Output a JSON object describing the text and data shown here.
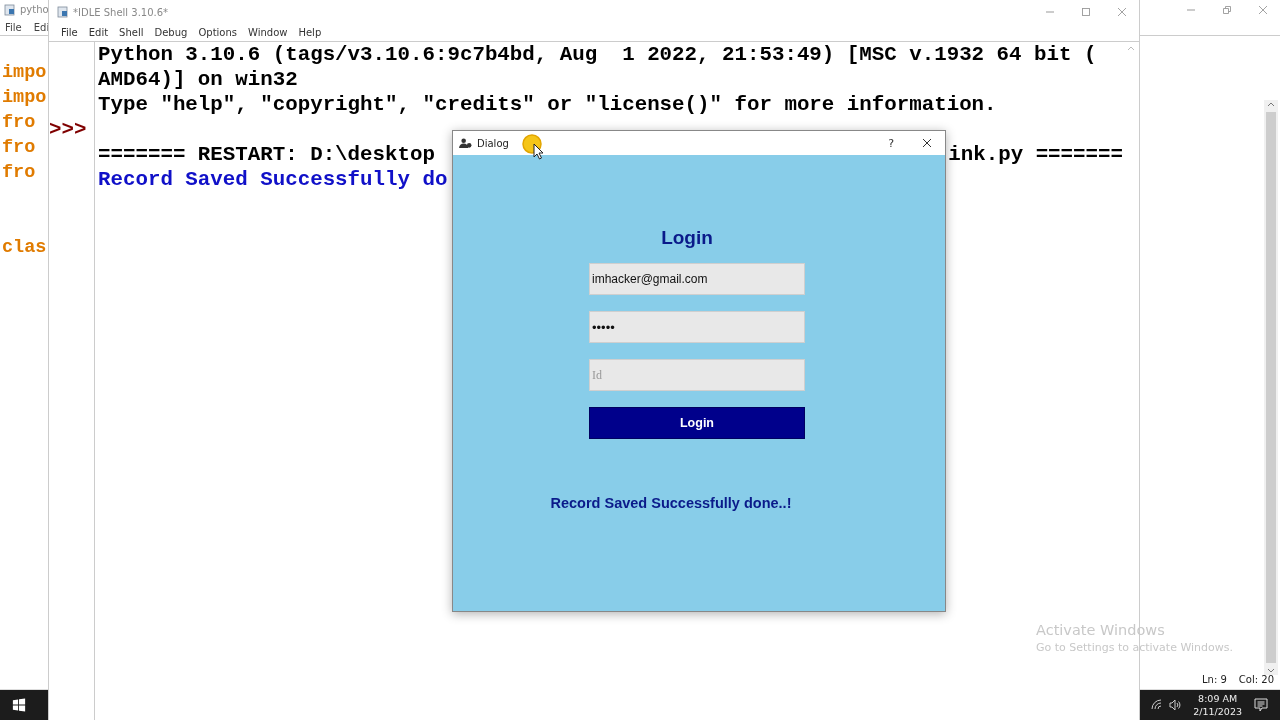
{
  "background_window": {
    "title": "pytho",
    "menu": [
      "File",
      "Edi"
    ],
    "code_lines": [
      {
        "kind": "code",
        "text": "impo"
      },
      {
        "kind": "code",
        "text": "impo"
      },
      {
        "kind": "code",
        "text": "fro"
      },
      {
        "kind": "code",
        "text": "fro"
      },
      {
        "kind": "code",
        "text": "fro"
      },
      {
        "kind": "blank"
      },
      {
        "kind": "blank"
      },
      {
        "kind": "code",
        "text": "clas"
      }
    ],
    "status": {
      "line": "Ln: 9",
      "column": "Col: 20"
    }
  },
  "shell_window": {
    "title": "*IDLE Shell 3.10.6*",
    "menu": [
      "File",
      "Edit",
      "Shell",
      "Debug",
      "Options",
      "Window",
      "Help"
    ],
    "lines": [
      {
        "kind": "info",
        "text": "Python 3.10.6 (tags/v3.10.6:9c7b4bd, Aug  1 2022, 21:53:49) [MSC v.1932 64 bit ("
      },
      {
        "kind": "info",
        "text": "AMD64)] on win32"
      },
      {
        "kind": "info",
        "text": "Type \"help\", \"copyright\", \"credits\" or \"license()\" for more information."
      },
      {
        "kind": "blank",
        "prompt": ">>>"
      },
      {
        "kind": "split",
        "left": "======= RESTART: D:\\desktop",
        "right": "ink.py ======="
      },
      {
        "kind": "output",
        "text": "Record Saved Successfully do"
      }
    ]
  },
  "dialog": {
    "title": "Dialog",
    "help": "?",
    "heading": "Login",
    "fields": [
      {
        "kind": "text",
        "value": "imhacker@gmail.com"
      },
      {
        "kind": "password",
        "value": "•••••"
      },
      {
        "kind": "text",
        "placeholder": "Id"
      }
    ],
    "button": "Login",
    "message": "Record Saved Successfully done..!"
  },
  "activation_notice": {
    "title": "Activate Windows",
    "text": "Go to Settings to activate Windows."
  },
  "taskbar": {
    "time": "8:09 AM",
    "date": "2/11/2023"
  }
}
